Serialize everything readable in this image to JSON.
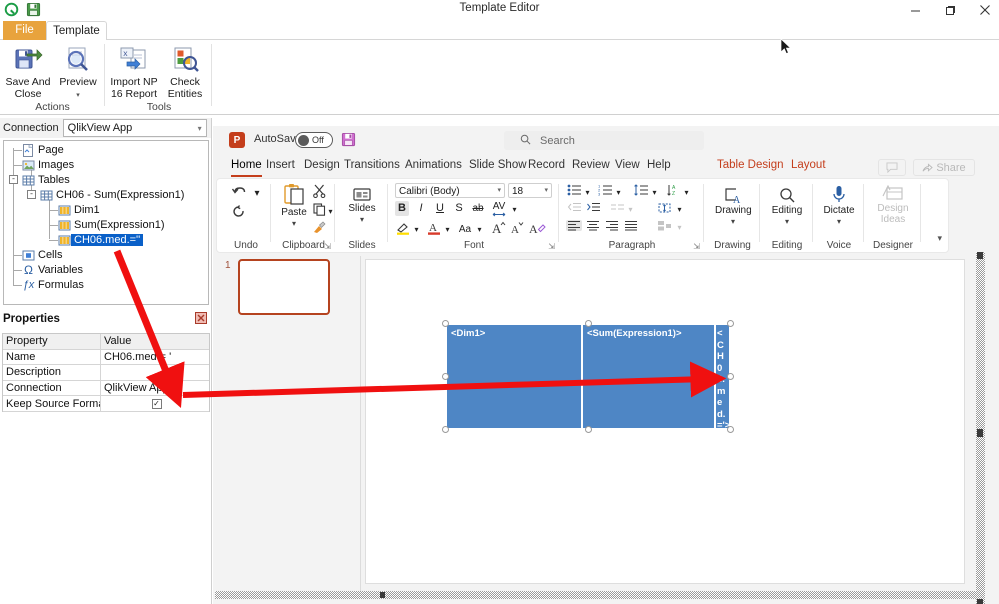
{
  "window": {
    "title": "Template Editor",
    "controls": {
      "minimize": "minimize-icon",
      "maximize": "maximize-icon",
      "close": "close-icon"
    },
    "quick_access": [
      "qlikview-logo-icon",
      "save-icon"
    ],
    "collapse_glyph": "⌃"
  },
  "ribbon": {
    "tabs": [
      {
        "label": "File",
        "active": false
      },
      {
        "label": "Template",
        "active": true
      }
    ],
    "groups": [
      {
        "label": "Actions",
        "buttons": [
          {
            "label_line1": "Save And",
            "label_line2": "Close",
            "icon": "save-and-close-icon",
            "caret": false
          },
          {
            "label_line1": "Preview",
            "label_line2": "",
            "icon": "preview-icon",
            "caret": true
          }
        ]
      },
      {
        "label": "Tools",
        "buttons": [
          {
            "label_line1": "Import NP",
            "label_line2": "16 Report",
            "icon": "import-np-report-icon",
            "caret": false
          },
          {
            "label_line1": "Check",
            "label_line2": "Entities",
            "icon": "check-entities-icon",
            "caret": false
          }
        ]
      }
    ]
  },
  "connection": {
    "label": "Connection",
    "value": "QlikView App",
    "caret": "∨"
  },
  "tree": {
    "nodes": [
      {
        "label": "Page",
        "icon": "page-icon",
        "depth": 1,
        "expander": "",
        "selected": false
      },
      {
        "label": "Images",
        "icon": "images-icon",
        "depth": 1,
        "expander": "",
        "selected": false
      },
      {
        "label": "Tables",
        "icon": "tables-icon",
        "depth": 1,
        "expander": "-",
        "selected": false
      },
      {
        "label": "CH06 - Sum(Expression1)",
        "icon": "table-icon",
        "depth": 2,
        "expander": "-",
        "selected": false
      },
      {
        "label": "Dim1",
        "icon": "column-icon",
        "depth": 3,
        "expander": "",
        "selected": false
      },
      {
        "label": "Sum(Expression1)",
        "icon": "column-icon",
        "depth": 3,
        "expander": "",
        "selected": false
      },
      {
        "label": "CH06.med.=''",
        "icon": "column-icon",
        "depth": 3,
        "expander": "",
        "selected": true
      },
      {
        "label": "Cells",
        "icon": "cells-icon",
        "depth": 1,
        "expander": "",
        "selected": false
      },
      {
        "label": "Variables",
        "icon": "variables-icon",
        "depth": 1,
        "expander": "",
        "selected": false
      },
      {
        "label": "Formulas",
        "icon": "formulas-icon",
        "depth": 1,
        "expander": "",
        "selected": false
      }
    ]
  },
  "properties": {
    "title": "Properties",
    "close_label": "✕",
    "columns": [
      "Property",
      "Value"
    ],
    "rows": [
      {
        "property": "Name",
        "value": "CH06.med.= '",
        "type": "text"
      },
      {
        "property": "Description",
        "value": "",
        "type": "text"
      },
      {
        "property": "Connection",
        "value": "QlikView App",
        "type": "text"
      },
      {
        "property": "Keep Source Formats",
        "value": "✓",
        "type": "checkbox"
      }
    ]
  },
  "powerpoint": {
    "logo_letter": "P",
    "autosave_label": "AutoSave",
    "autosave_state": "Off",
    "save_icon": "save-icon",
    "search_placeholder": "Search",
    "search_icon": "search-icon",
    "tabs": [
      {
        "label": "Home",
        "active": true,
        "contextual": false
      },
      {
        "label": "Insert",
        "active": false,
        "contextual": false
      },
      {
        "label": "Design",
        "active": false,
        "contextual": false
      },
      {
        "label": "Transitions",
        "active": false,
        "contextual": false
      },
      {
        "label": "Animations",
        "active": false,
        "contextual": false
      },
      {
        "label": "Slide Show",
        "active": false,
        "contextual": false
      },
      {
        "label": "Record",
        "active": false,
        "contextual": false
      },
      {
        "label": "Review",
        "active": false,
        "contextual": false
      },
      {
        "label": "View",
        "active": false,
        "contextual": false
      },
      {
        "label": "Help",
        "active": false,
        "contextual": false
      },
      {
        "label": "Table Design",
        "active": false,
        "contextual": true
      },
      {
        "label": "Layout",
        "active": false,
        "contextual": true
      }
    ],
    "share_label": "Share",
    "comment_icon": "comment-icon",
    "ribbon_groups": [
      {
        "label": "Undo",
        "launcher": false
      },
      {
        "label": "Clipboard",
        "launcher": true
      },
      {
        "label": "Slides",
        "launcher": false
      },
      {
        "label": "Font",
        "launcher": true
      },
      {
        "label": "Paragraph",
        "launcher": true
      },
      {
        "label": "Drawing",
        "launcher": false
      },
      {
        "label": "Editing",
        "launcher": false
      },
      {
        "label": "Voice",
        "launcher": false
      },
      {
        "label": "Designer",
        "launcher": false
      }
    ],
    "buttons": {
      "paste": "Paste",
      "slides": "Slides",
      "drawing": "Drawing",
      "editing": "Editing",
      "dictate": "Dictate",
      "design_ideas_line1": "Design",
      "design_ideas_line2": "Ideas"
    },
    "font": {
      "family": "Calibri (Body)",
      "size": "18",
      "bold": "B",
      "italic": "I",
      "underline": "U",
      "shadow": "S",
      "strikethrough": "ab",
      "spacing": "AV",
      "change_case": "Aa",
      "grow": "A",
      "shrink": "A",
      "clear_formatting": "A"
    },
    "slide_panel": {
      "slide_number": "1"
    },
    "table": {
      "columns": [
        "<Dim1>",
        "<Sum(Expression1)>",
        "<CH06.med.='>"
      ],
      "cell3_wrapped": "<CH06.med.='>",
      "fill_color": "#4e86c5"
    }
  },
  "annotations": {
    "arrow_color": "#f01010",
    "arrow_1": "tree-to-connection-value-arrow",
    "arrow_2": "properties-to-table-cell-arrow"
  }
}
